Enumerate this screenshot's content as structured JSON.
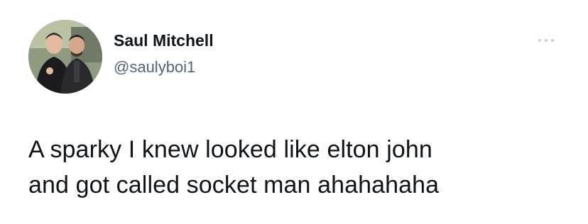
{
  "tweet": {
    "author": {
      "display_name": "Saul Mitchell",
      "handle": "@saulyboi1"
    },
    "more_menu_icon": "more-horizontal-icon",
    "text_lines": [
      "A sparky I knew looked like elton john",
      "and got called socket man ahahahaha"
    ]
  },
  "colors": {
    "background": "#ffffff",
    "name": "#0f1419",
    "handle": "#536471",
    "more_icon": "#c9ced3"
  }
}
